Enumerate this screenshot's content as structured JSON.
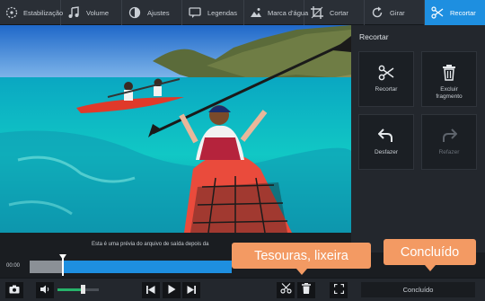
{
  "toolbar": {
    "items": [
      {
        "label": "Estabilização",
        "icon": "stabilization-icon"
      },
      {
        "label": "Volume",
        "icon": "music-note-icon"
      },
      {
        "label": "Ajustes",
        "icon": "contrast-icon"
      },
      {
        "label": "Legendas",
        "icon": "subtitles-icon"
      },
      {
        "label": "Marca d'água",
        "icon": "watermark-icon"
      },
      {
        "label": "Cortar",
        "icon": "crop-icon"
      },
      {
        "label": "Girar",
        "icon": "rotate-icon"
      },
      {
        "label": "Recortar",
        "icon": "scissors-icon",
        "active": true
      }
    ],
    "accent": "#1e8fe0"
  },
  "panel": {
    "title": "Recortar",
    "buttons": [
      {
        "label": "Recortar",
        "icon": "scissors-icon"
      },
      {
        "label": "Excluir fragmento",
        "icon": "trash-icon"
      },
      {
        "label": "Desfazer",
        "icon": "undo-icon"
      },
      {
        "label": "Refazer",
        "icon": "redo-icon",
        "disabled": true
      }
    ]
  },
  "status": {
    "text": "Esta é uma prévia do arquivo de saída depois da"
  },
  "timeline": {
    "time": "00:00"
  },
  "controls": {
    "done_label": "Concluído",
    "volume_level": 0.6
  },
  "callouts": {
    "tools": "Tesouras, lixeira",
    "done": "Concluído",
    "color": "#f39a63"
  }
}
